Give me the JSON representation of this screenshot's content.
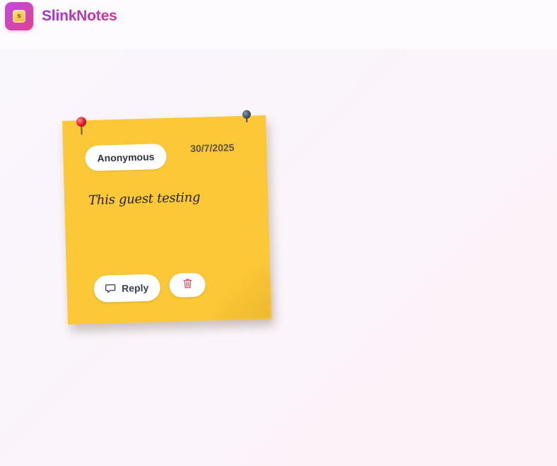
{
  "app": {
    "name": "SlinkNotes",
    "logo_letter": "s"
  },
  "note": {
    "author": "Anonymous",
    "date": "30/7/2025",
    "message": "This guest testing",
    "reply_label": "Reply",
    "color": "#fdc837"
  },
  "colors": {
    "brand_gradient_start": "#9b35d8",
    "brand_gradient_end": "#d8348c",
    "delete_icon": "#e0505a"
  },
  "icons": {
    "reply": "chat-bubble-icon",
    "delete": "trash-icon",
    "pin_left": "red-pushpin-icon",
    "pin_right": "dark-pushpin-icon"
  }
}
